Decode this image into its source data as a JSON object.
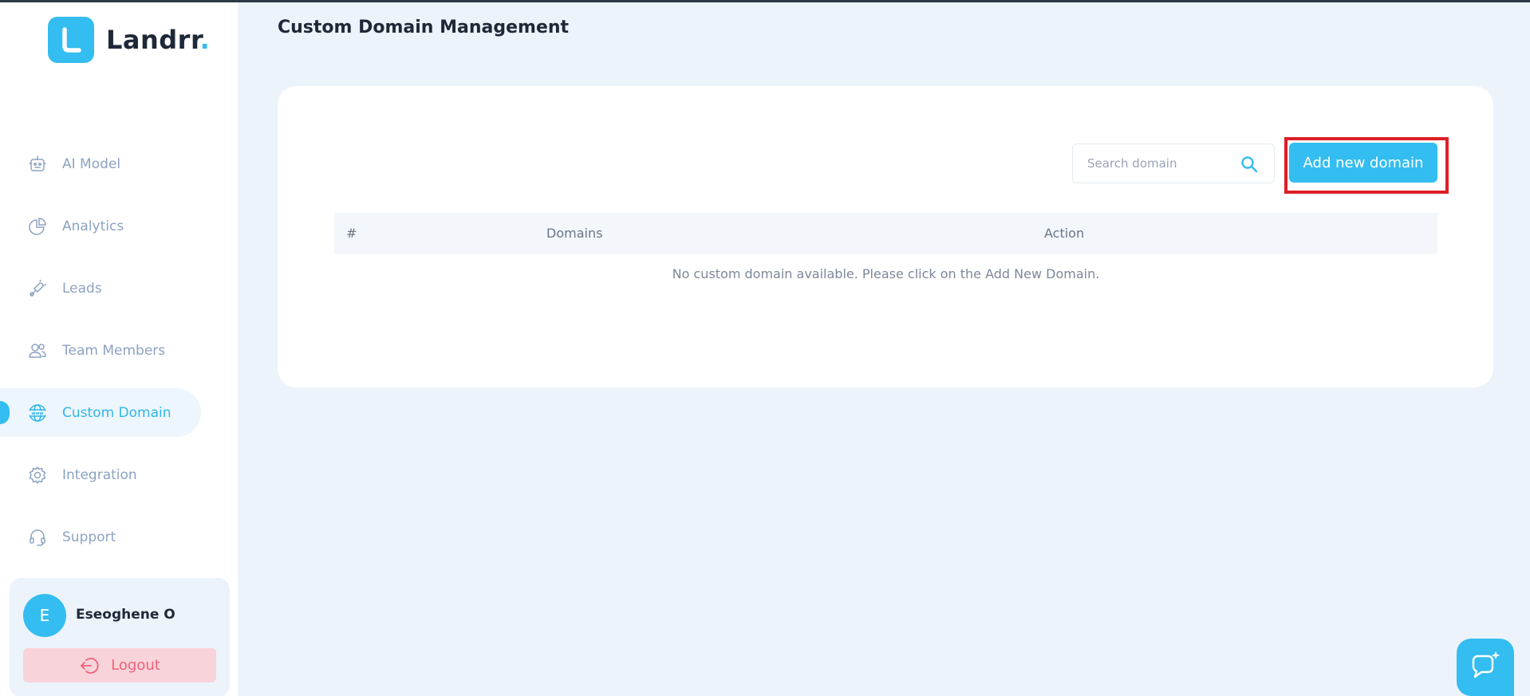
{
  "brand": {
    "name": "Landrr",
    "dot": "."
  },
  "nav": {
    "items": [
      {
        "label": "AI Model",
        "icon": "robot-icon"
      },
      {
        "label": "Analytics",
        "icon": "pie-chart-icon"
      },
      {
        "label": "Leads",
        "icon": "leads-icon"
      },
      {
        "label": "Team Members",
        "icon": "users-icon"
      },
      {
        "label": "Custom Domain",
        "icon": "www-globe-icon",
        "active": true
      },
      {
        "label": "Integration",
        "icon": "gear-icon"
      },
      {
        "label": "Support",
        "icon": "headset-icon"
      }
    ]
  },
  "user": {
    "initial": "E",
    "name": "Eseoghene O",
    "logout_label": "Logout"
  },
  "main": {
    "title": "Custom Domain Management",
    "search": {
      "placeholder": "Search domain",
      "value": ""
    },
    "add_button_label": "Add new domain",
    "table": {
      "columns": [
        "#",
        "Domains",
        "Action"
      ],
      "empty_message": "No custom domain available. Please click on the Add New Domain."
    }
  },
  "colors": {
    "accent": "#34bdf0",
    "background": "#ecf3fa",
    "logout_bg": "#f8d3d9",
    "logout_text": "#f0627c",
    "highlight_border": "#de1f27"
  }
}
